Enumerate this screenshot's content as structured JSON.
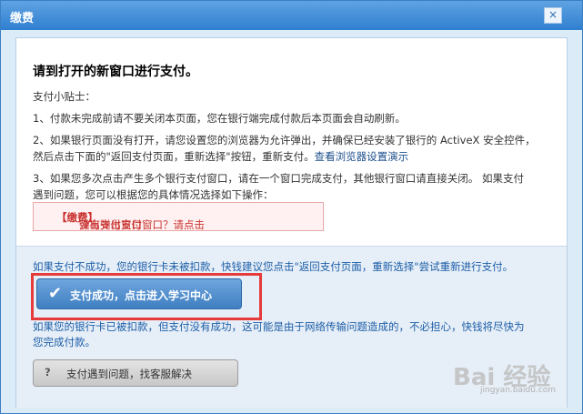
{
  "window": {
    "title": "缴费",
    "close_glyph": "×"
  },
  "main": {
    "heading": "请到打开的新窗口进行支付。",
    "tips_title": "支付小贴士：",
    "tip1": "1、付款未完成前请不要关闭本页面，您在银行端完成付款后本页面会自动刷新。",
    "tip2_line1": "2、如果银行页面没有打开，请您设置您的浏览器为允许弹出，并确保已经安装了银行的 ActiveX 安全控件，",
    "tip2_line2_text": "然后点击下面的\"返回支付页面，重新选择\"按钮，重新支付。",
    "tip2_link": "查看浏览器设置演示",
    "tip3_line1": "3、如果您多次点击产生多个银行支付窗口，请在一个窗口完成支付，其他银行窗口请直接关闭。 如果支付",
    "tip3_line2": "遇到问题，您可以根据您的具体情况选择如下操作："
  },
  "notice": {
    "prefix": "没有弹出支付窗口？请点击",
    "link": "【缴费】",
    "suffix": "弹出支付窗口"
  },
  "lower": {
    "fail_text": "如果支付不成功，您的银行卡未被扣款，快钱建议您点击\"返回支付页面，重新选择\"尝试重新进行支付。",
    "success_button": "支付成功，点击进入学习中心",
    "deducted_line1": "如果您的银行卡已被扣款，但支付没有成功，这可能是由于网络传输问题造成的，不必担心，快钱将尽快为",
    "deducted_line2": "您完成付款。",
    "help_button": "支付遇到问题，找客服解决"
  },
  "watermark": {
    "main": "Bai 经验",
    "sub": "jingyan.baidu.com"
  },
  "colors": {
    "titlebar": "#2f7fd0",
    "primary_button": "#4a86c6",
    "highlight_frame": "#e53b3b",
    "notice_text": "#c8322f"
  }
}
